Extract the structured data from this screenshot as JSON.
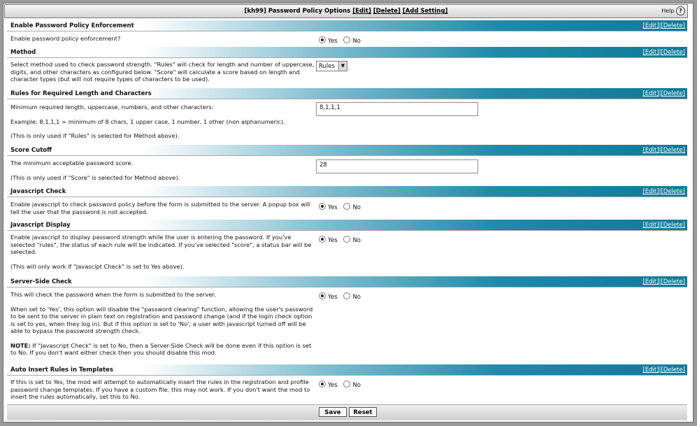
{
  "title": {
    "name": "[kh99] Password Policy Options",
    "edit": "[Edit]",
    "delete": "[Delete]",
    "add": "[Add Setting]",
    "help_label": "Help",
    "help_icon": "?"
  },
  "action_edit": "[Edit]",
  "action_delete": "[Delete]",
  "sections": [
    {
      "title": "Enable Password Policy Enforcement",
      "lines": [
        "Enable password policy enforcement?"
      ],
      "control": "radio",
      "selected": "Yes"
    },
    {
      "title": "Method",
      "lines": [
        "Select method used to check password strength. \"Rules\" will check for length and number of uppercase, digits, and other characters as configured below. \"Score\" will calculate a score based on length and character types (but will not require types of characters to be used)."
      ],
      "control": "select",
      "value": "Rules"
    },
    {
      "title": "Rules for Required Length and Characters",
      "lines": [
        "Minimum required length, uppercase, numbers, and other characters:",
        "Example: 8,1,1,1 = minimum of 8 chars, 1 upper case, 1 number, 1 other (non alphanumeric).",
        "(This is only used if \"Rules\" is selected for Method above)."
      ],
      "control": "text",
      "value": "8,1,1,1"
    },
    {
      "title": "Score Cutoff",
      "lines": [
        "The minimum acceptable password score.",
        "(This is only used if \"Score\" is selected for Method above)."
      ],
      "control": "text",
      "value": "28"
    },
    {
      "title": "Javascript Check",
      "lines": [
        "Enable javascript to check password policy before the form is submitted to the server. A popup box will tell the user that the password is not accepted."
      ],
      "control": "radio",
      "selected": "Yes"
    },
    {
      "title": "Javascript Display",
      "lines": [
        "Enable javascript to display password strength while the user is entering the password. If you've selected \"rules\", the status of each rule will be indicated. If you've selected \"score\", a status bar will be selected.",
        "(This will only work if \"Javascipt Check\" is set to Yes above)."
      ],
      "control": "radio",
      "selected": "Yes"
    },
    {
      "title": "Server-Side Check",
      "lines": [
        "This will check the password when the form is submitted to the server.",
        "When set to 'Yes', this option will disable the \"password clearing\" function, allowing the user's password to be sent to the server in plain text on registration and password change (and if the login check option is set to yes, when they log in). But if this option is set to 'No', a user with javascript turned off will be able to bypass the password strength check."
      ],
      "note_label": "NOTE:",
      "note_text": " If \"Javascript Check\" is set to No, then a Server-Side Check will be done even if this option is set to No. If you don't want either check then you should disable this mod.",
      "control": "radio",
      "selected": "Yes"
    },
    {
      "title": "Auto Insert Rules in Templates",
      "lines": [
        "If this is set to Yes, the mod will attempt to automatically insert the rules in the registration and profile password change templates. If you have a custom file, this may not work. If you don't want the mod to insert the rules automatically, set this to No."
      ],
      "control": "radio",
      "selected": "Yes"
    }
  ],
  "options": {
    "yes": "Yes",
    "no": "No"
  },
  "footer": {
    "save": "Save",
    "reset": "Reset"
  }
}
